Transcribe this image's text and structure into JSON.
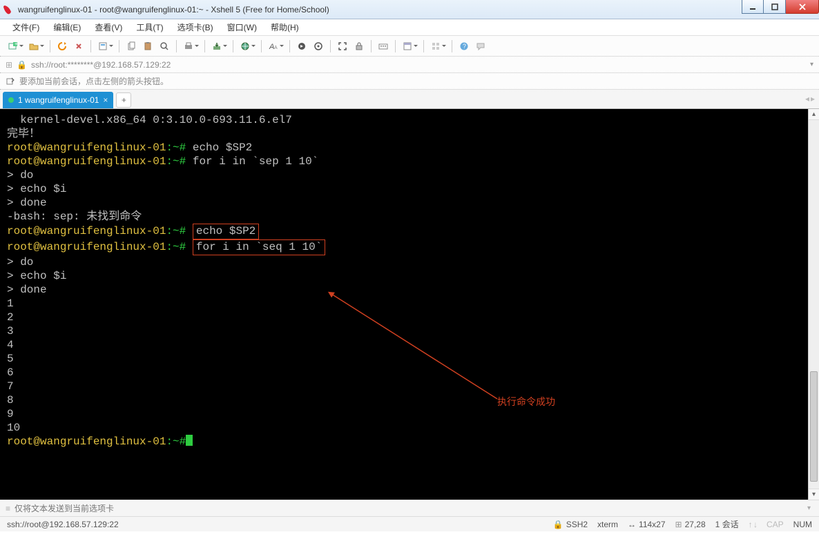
{
  "window": {
    "title": "wangruifenglinux-01 - root@wangruifenglinux-01:~ - Xshell 5 (Free for Home/School)"
  },
  "menu": {
    "items": [
      "文件(F)",
      "编辑(E)",
      "查看(V)",
      "工具(T)",
      "选项卡(B)",
      "窗口(W)",
      "帮助(H)"
    ]
  },
  "addrbar": {
    "url": "ssh://root:********@192.168.57.129:22"
  },
  "hint": {
    "text": "要添加当前会话，点击左侧的箭头按钮。"
  },
  "tabs": {
    "items": [
      {
        "label": "1 wangruifenglinux-01"
      }
    ],
    "add": "+"
  },
  "terminal": {
    "prompt_user": "root@wangruifenglinux-01",
    "prompt_path": ":~#",
    "lines": {
      "kernel": "  kernel-devel.x86_64 0:3.10.0-693.11.6.el7",
      "blank": "",
      "done_cn": "完毕！",
      "cmd_echo1": " echo $SP2",
      "cmd_for1": " for i in `sep 1 10`",
      "do": "> do",
      "echoi": "> echo $i",
      "done": "> done",
      "bash_err": "-bash: sep: 未找到命令",
      "cmd_echo2": "echo $SP2",
      "cmd_for2": "for i in `seq 1 10`",
      "n1": "1",
      "n2": "2",
      "n3": "3",
      "n4": "4",
      "n5": "5",
      "n6": "6",
      "n7": "7",
      "n8": "8",
      "n9": "9",
      "n10": "10"
    },
    "annotation_label": "执行命令成功"
  },
  "sendbar": {
    "placeholder": "仅将文本发送到当前选项卡"
  },
  "status": {
    "left": "ssh://root@192.168.57.129:22",
    "proto": "SSH2",
    "term": "xterm",
    "size": "114x27",
    "pos": "27,28",
    "sessions": "1 会话",
    "cap": "CAP",
    "num": "NUM"
  }
}
